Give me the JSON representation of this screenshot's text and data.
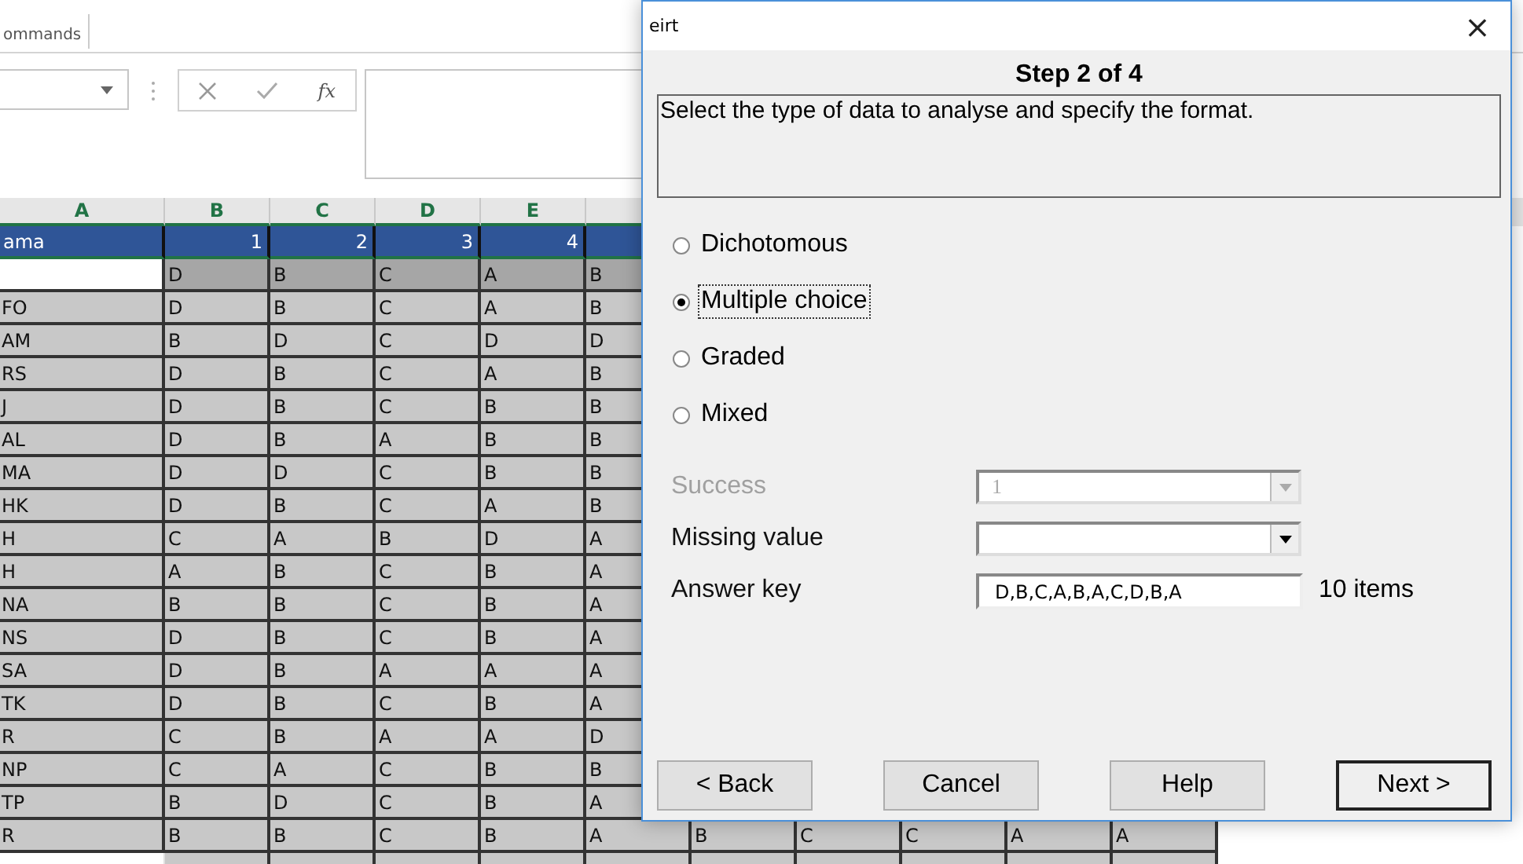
{
  "ribbon": {
    "group_label": "ommands"
  },
  "formula_bar": {
    "function_label": "fx"
  },
  "sheet": {
    "columns": [
      "A",
      "B",
      "C",
      "D",
      "E"
    ],
    "rows": [
      {
        "kind": "title",
        "name": "ama",
        "values": [
          "1",
          "2",
          "3",
          "4"
        ]
      },
      {
        "kind": "key",
        "values": [
          "D",
          "B",
          "C",
          "A",
          "B"
        ]
      },
      {
        "kind": "data",
        "name": "FO",
        "values": [
          "D",
          "B",
          "C",
          "A",
          "B"
        ]
      },
      {
        "kind": "data",
        "name": "AM",
        "values": [
          "B",
          "D",
          "C",
          "D",
          "D"
        ]
      },
      {
        "kind": "data",
        "name": "RS",
        "values": [
          "D",
          "B",
          "C",
          "A",
          "B"
        ]
      },
      {
        "kind": "data",
        "name": "J",
        "values": [
          "D",
          "B",
          "C",
          "B",
          "B"
        ]
      },
      {
        "kind": "data",
        "name": "AL",
        "values": [
          "D",
          "B",
          "A",
          "B",
          "B"
        ]
      },
      {
        "kind": "data",
        "name": "MA",
        "values": [
          "D",
          "D",
          "C",
          "B",
          "B"
        ]
      },
      {
        "kind": "data",
        "name": "HK",
        "values": [
          "D",
          "B",
          "C",
          "A",
          "B"
        ]
      },
      {
        "kind": "data",
        "name": "H",
        "values": [
          "C",
          "A",
          "B",
          "D",
          "A"
        ]
      },
      {
        "kind": "data",
        "name": "H",
        "values": [
          "A",
          "B",
          "C",
          "B",
          "A"
        ]
      },
      {
        "kind": "data",
        "name": "NA",
        "values": [
          "B",
          "B",
          "C",
          "B",
          "A"
        ]
      },
      {
        "kind": "data",
        "name": "NS",
        "values": [
          "D",
          "B",
          "C",
          "B",
          "A"
        ]
      },
      {
        "kind": "data",
        "name": "SA",
        "values": [
          "D",
          "B",
          "A",
          "A",
          "A"
        ]
      },
      {
        "kind": "data",
        "name": "TK",
        "values": [
          "D",
          "B",
          "C",
          "B",
          "A"
        ]
      },
      {
        "kind": "data",
        "name": "R",
        "values": [
          "C",
          "B",
          "A",
          "A",
          "D"
        ]
      },
      {
        "kind": "data",
        "name": "NP",
        "values": [
          "C",
          "A",
          "C",
          "B",
          "B"
        ]
      },
      {
        "kind": "data",
        "name": "TP",
        "values": [
          "B",
          "D",
          "C",
          "B",
          "A"
        ]
      },
      {
        "kind": "data",
        "name": "R",
        "values": [
          "B",
          "B",
          "C",
          "B",
          "A",
          "B",
          "C",
          "C",
          "A",
          "A"
        ]
      }
    ]
  },
  "dialog": {
    "title": "eirt",
    "close": "×",
    "step": "Step 2 of 4",
    "instructions": "Select the type of data to analyse and specify the format.",
    "data_types": [
      {
        "label": "Dichotomous",
        "selected": false
      },
      {
        "label": "Multiple choice",
        "selected": true
      },
      {
        "label": "Graded",
        "selected": false
      },
      {
        "label": "Mixed",
        "selected": false
      }
    ],
    "fields": [
      {
        "kind": "combo",
        "label": "Success",
        "value": "1",
        "disabled": true
      },
      {
        "kind": "combo",
        "label": "Missing value",
        "disabled": false
      },
      {
        "kind": "text",
        "label": "Answer key",
        "value": "D,B,C,A,B,A,C,D,B,A",
        "note": "10 items",
        "disabled": false
      }
    ],
    "buttons": [
      {
        "label": "< Back",
        "default": false
      },
      {
        "label": "Cancel",
        "default": false
      },
      {
        "label": "Help",
        "default": false
      },
      {
        "label": "Next >",
        "default": true
      }
    ]
  }
}
